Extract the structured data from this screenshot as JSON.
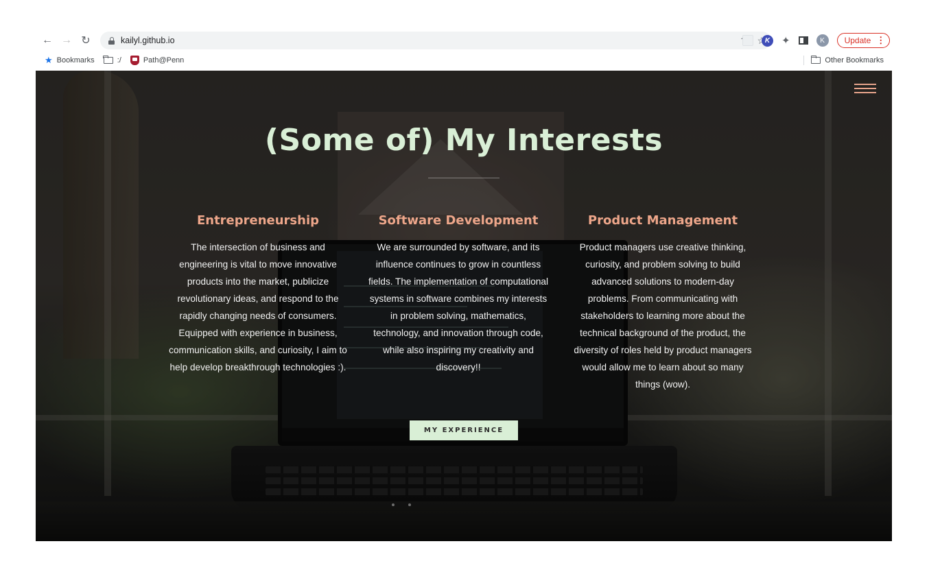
{
  "browser": {
    "url": "kailyl.github.io",
    "avatar_letter": "K",
    "update_label": "Update",
    "update_menu": "⋮",
    "extension_letter": "K",
    "bookmarks": [
      {
        "label": "Bookmarks",
        "icon": "star-icon"
      },
      {
        "label": ":/",
        "icon": "folder-icon"
      },
      {
        "label": "Path@Penn",
        "icon": "penn-shield-icon"
      }
    ],
    "other_bookmarks": "Other Bookmarks"
  },
  "hero": {
    "title": "(Some of) My Interests",
    "columns": [
      {
        "heading": "Entrepreneurship",
        "text": "The intersection of business and engineering is vital to move innovative products into the market, publicize revolutionary ideas, and respond to the rapidly changing needs of consumers. Equipped with experience in business, communication skills, and curiosity, I aim to help develop breakthrough technologies :)."
      },
      {
        "heading": "Software Development",
        "text": "We are surrounded by software, and its influence continues to grow in countless fields. The implementation of computational systems in software combines my interests in problem solving, mathematics, technology, and innovation through code, while also inspiring my creativity and discovery!!"
      },
      {
        "heading": "Product Management",
        "text": "Product managers use creative thinking, curiosity, and problem solving to build advanced solutions to modern-day problems. From communicating with stakeholders to learning more about the technical background of the product, the diversity of roles held by product managers would allow me to learn about so many things (wow)."
      }
    ],
    "button_label": "MY EXPERIENCE"
  },
  "colors": {
    "title": "#d9efd6",
    "heading": "#eda68a",
    "button_bg": "#d9efd6",
    "update_red": "#d93025"
  }
}
